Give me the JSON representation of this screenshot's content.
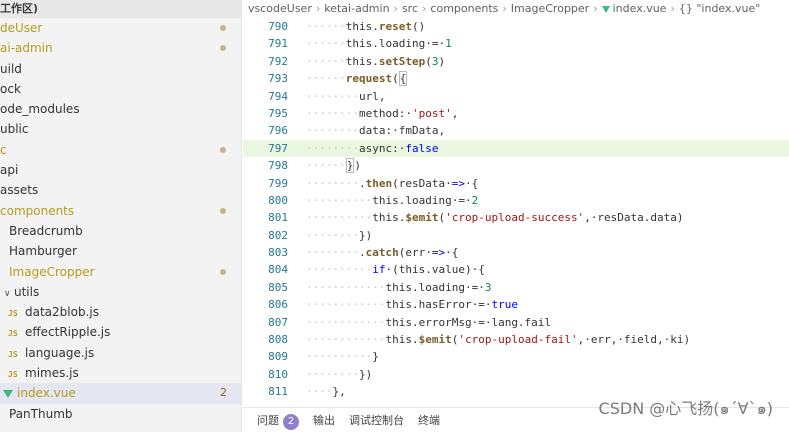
{
  "sidebar": {
    "header": "工作区)",
    "items": [
      {
        "label": "deUser",
        "indent": 0,
        "color": "#b59b1d",
        "dot": true
      },
      {
        "label": "ai-admin",
        "indent": 0,
        "color": "#b59b1d",
        "dot": true
      },
      {
        "label": "uild",
        "indent": 0,
        "color": "#333"
      },
      {
        "label": "ock",
        "indent": 0,
        "color": "#333"
      },
      {
        "label": "ode_modules",
        "indent": 0,
        "color": "#333"
      },
      {
        "label": "ublic",
        "indent": 0,
        "color": "#333"
      },
      {
        "label": "c",
        "indent": 0,
        "color": "#b59b1d",
        "dot": true
      },
      {
        "label": "api",
        "indent": 0,
        "color": "#333"
      },
      {
        "label": "assets",
        "indent": 0,
        "color": "#333"
      },
      {
        "label": "components",
        "indent": 0,
        "color": "#b59b1d",
        "dot": true
      },
      {
        "label": "Breadcrumb",
        "indent": 9,
        "color": "#333"
      },
      {
        "label": "Hamburger",
        "indent": 9,
        "color": "#333"
      },
      {
        "label": "ImageCropper",
        "indent": 9,
        "color": "#b59b1d",
        "dot": true
      },
      {
        "label": "utils",
        "indent": 4,
        "color": "#333",
        "chevron": "∨"
      },
      {
        "label": "data2blob.js",
        "indent": 8,
        "color": "#333",
        "icon": "JS"
      },
      {
        "label": "effectRipple.js",
        "indent": 8,
        "color": "#333",
        "icon": "JS"
      },
      {
        "label": "language.js",
        "indent": 8,
        "color": "#333",
        "icon": "JS"
      },
      {
        "label": "mimes.js",
        "indent": 8,
        "color": "#333",
        "icon": "JS"
      },
      {
        "label": "index.vue",
        "indent": 3,
        "color": "#b59b1d",
        "icon": "vue",
        "badge": "2",
        "active": true
      },
      {
        "label": "PanThumb",
        "indent": 9,
        "color": "#333"
      }
    ]
  },
  "breadcrumb": {
    "parts": [
      "vscodeUser",
      "ketai-admin",
      "src",
      "components",
      "ImageCropper",
      "index.vue",
      "{} \"index.vue\""
    ]
  },
  "editor": {
    "lines": [
      {
        "num": "790",
        "ws": "······",
        "segs": [
          [
            "prop",
            "this."
          ],
          [
            "fn",
            "reset"
          ],
          [
            "prop",
            "()"
          ]
        ]
      },
      {
        "num": "791",
        "ws": "······",
        "segs": [
          [
            "prop",
            "this.loading·=·"
          ],
          [
            "num",
            "1"
          ]
        ]
      },
      {
        "num": "792",
        "ws": "······",
        "segs": [
          [
            "prop",
            "this."
          ],
          [
            "fn",
            "setStep"
          ],
          [
            "prop",
            "("
          ],
          [
            "num",
            "3"
          ],
          [
            "prop",
            ")"
          ]
        ]
      },
      {
        "num": "793",
        "ws": "······",
        "segs": [
          [
            "fn",
            "request"
          ],
          [
            "prop",
            "("
          ],
          [
            "cursor",
            "{"
          ]
        ]
      },
      {
        "num": "794",
        "ws": "········",
        "segs": [
          [
            "prop",
            "url,"
          ]
        ]
      },
      {
        "num": "795",
        "ws": "········",
        "segs": [
          [
            "prop",
            "method:·"
          ],
          [
            "str",
            "'post'"
          ],
          [
            "prop",
            ","
          ]
        ]
      },
      {
        "num": "796",
        "ws": "········",
        "segs": [
          [
            "prop",
            "data:·fmData,"
          ]
        ]
      },
      {
        "num": "797",
        "ws": "········",
        "segs": [
          [
            "prop",
            "async:·"
          ],
          [
            "kw",
            "false"
          ]
        ],
        "highlight": true
      },
      {
        "num": "798",
        "ws": "······",
        "segs": [
          [
            "cursor",
            "}"
          ],
          [
            "prop",
            ")"
          ]
        ]
      },
      {
        "num": "799",
        "ws": "········",
        "segs": [
          [
            "prop",
            "."
          ],
          [
            "fn",
            "then"
          ],
          [
            "prop",
            "(resData·"
          ],
          [
            "kw",
            "=>"
          ],
          [
            "prop",
            "·{"
          ]
        ]
      },
      {
        "num": "800",
        "ws": "··········",
        "segs": [
          [
            "prop",
            "this.loading·=·"
          ],
          [
            "num",
            "2"
          ]
        ]
      },
      {
        "num": "801",
        "ws": "··········",
        "segs": [
          [
            "prop",
            "this."
          ],
          [
            "fn",
            "$emit"
          ],
          [
            "prop",
            "("
          ],
          [
            "str",
            "'crop-upload-success'"
          ],
          [
            "prop",
            ",·resData.data)"
          ]
        ]
      },
      {
        "num": "802",
        "ws": "········",
        "segs": [
          [
            "prop",
            "})"
          ]
        ]
      },
      {
        "num": "803",
        "ws": "········",
        "segs": [
          [
            "prop",
            "."
          ],
          [
            "fn",
            "catch"
          ],
          [
            "prop",
            "(err·"
          ],
          [
            "kw",
            "=>"
          ],
          [
            "prop",
            "·{"
          ]
        ]
      },
      {
        "num": "804",
        "ws": "··········",
        "segs": [
          [
            "kw",
            "if"
          ],
          [
            "prop",
            "·(this.value)·{"
          ]
        ]
      },
      {
        "num": "805",
        "ws": "············",
        "segs": [
          [
            "prop",
            "this.loading·=·"
          ],
          [
            "num",
            "3"
          ]
        ]
      },
      {
        "num": "806",
        "ws": "············",
        "segs": [
          [
            "prop",
            "this.hasError·=·"
          ],
          [
            "kw",
            "true"
          ]
        ]
      },
      {
        "num": "807",
        "ws": "············",
        "segs": [
          [
            "prop",
            "this.errorMsg·=·lang.fail"
          ]
        ]
      },
      {
        "num": "808",
        "ws": "············",
        "segs": [
          [
            "prop",
            "this."
          ],
          [
            "fn",
            "$emit"
          ],
          [
            "prop",
            "("
          ],
          [
            "str",
            "'crop-upload-fail'"
          ],
          [
            "prop",
            ",·err,·field,·ki)"
          ]
        ]
      },
      {
        "num": "809",
        "ws": "··········",
        "segs": [
          [
            "prop",
            "}"
          ]
        ]
      },
      {
        "num": "810",
        "ws": "········",
        "segs": [
          [
            "prop",
            "})"
          ]
        ]
      },
      {
        "num": "811",
        "ws": "····",
        "segs": [
          [
            "prop",
            "},"
          ]
        ]
      }
    ]
  },
  "panel": {
    "tabs": [
      {
        "label": "问题",
        "badge": "2"
      },
      {
        "label": "输出"
      },
      {
        "label": "调试控制台"
      },
      {
        "label": "终端"
      }
    ]
  },
  "watermark": "CSDN @心飞扬(๑´∀`๑)"
}
